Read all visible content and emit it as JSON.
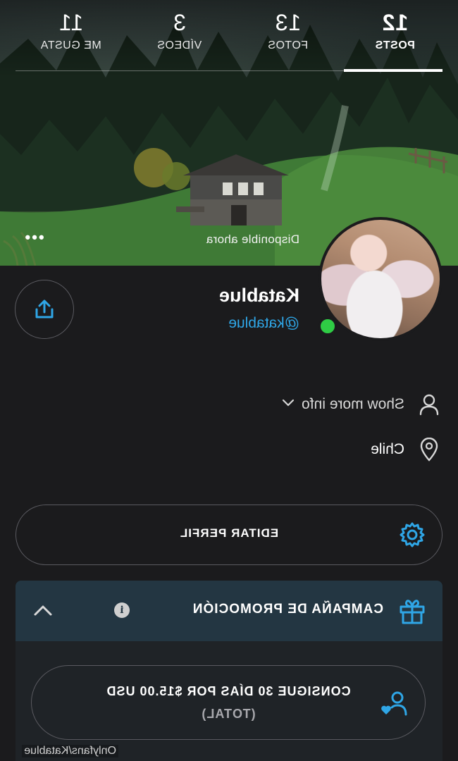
{
  "stats": [
    {
      "count": "12",
      "label": "POSTS",
      "active": true
    },
    {
      "count": "13",
      "label": "FOTOS",
      "active": false
    },
    {
      "count": "3",
      "label": "VÍDEOS",
      "active": false
    },
    {
      "count": "11",
      "label": "ME GUSTA",
      "active": false
    }
  ],
  "cover": {
    "status_text": "Disponible ahora",
    "more_icon": "more-dots-icon"
  },
  "profile": {
    "name": "Katablue",
    "handle": "@katablue",
    "online": true,
    "online_color": "#2fcc45"
  },
  "info": {
    "show_more_label": "Show more info",
    "location": "Chile"
  },
  "actions": {
    "edit_profile_label": "EDITAR PERFIL"
  },
  "promo": {
    "title": "CAMPAÑA DE PROMOCIÓN",
    "info_glyph": "i",
    "offer_line1": "CONSIGUE 30 DÍAS POR $15.00 USD",
    "offer_line2": "(TOTAL)"
  },
  "watermark": "Onlyfans/Katablue",
  "colors": {
    "accent": "#2fa6e6",
    "background": "#1b1b1d",
    "promo_header": "#233642"
  }
}
